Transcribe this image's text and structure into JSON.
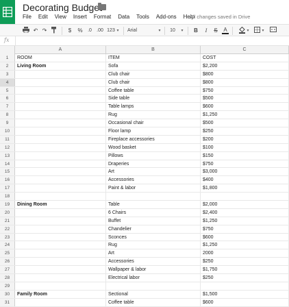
{
  "title_bar": {
    "doc_title": "Decorating Budget",
    "save_status": "All changes saved in Drive"
  },
  "menu": [
    "File",
    "Edit",
    "View",
    "Insert",
    "Format",
    "Data",
    "Tools",
    "Add-ons",
    "Help"
  ],
  "toolbar": {
    "currency": "$",
    "percent": "%",
    "decrease_decimals": ".0",
    "increase_decimals": ".00",
    "more_formats": "123",
    "font": "Arial",
    "font_size": "10",
    "bold": "B",
    "italic": "I",
    "strikethrough": "S",
    "text_color": "A"
  },
  "formula_bar": {
    "fx_label": "fx",
    "value": ""
  },
  "columns": [
    "A",
    "B",
    "C"
  ],
  "rows": [
    {
      "n": "1",
      "a": "ROOM",
      "b": "ITEM",
      "c": "COST"
    },
    {
      "n": "2",
      "a": "Living Room",
      "b": "Sofa",
      "c": "$2,200",
      "bold_a": true
    },
    {
      "n": "3",
      "a": "",
      "b": "Club chair",
      "c": "$800"
    },
    {
      "n": "4",
      "a": "",
      "b": "Club chair",
      "c": "$800",
      "selected": true
    },
    {
      "n": "5",
      "a": "",
      "b": "Coffee table",
      "c": "$750"
    },
    {
      "n": "6",
      "a": "",
      "b": "Side table",
      "c": "$500"
    },
    {
      "n": "7",
      "a": "",
      "b": "Table lamps",
      "c": "$600"
    },
    {
      "n": "8",
      "a": "",
      "b": "Rug",
      "c": "$1,250"
    },
    {
      "n": "9",
      "a": "",
      "b": "Occasional chair",
      "c": "$500"
    },
    {
      "n": "10",
      "a": "",
      "b": "Floor lamp",
      "c": "$250"
    },
    {
      "n": "11",
      "a": "",
      "b": "Fireplace accessories",
      "c": "$200"
    },
    {
      "n": "12",
      "a": "",
      "b": "Wood basket",
      "c": "$100"
    },
    {
      "n": "13",
      "a": "",
      "b": "Pillows",
      "c": "$150"
    },
    {
      "n": "14",
      "a": "",
      "b": "Draperies",
      "c": "$750"
    },
    {
      "n": "15",
      "a": "",
      "b": "Art",
      "c": "$3,000"
    },
    {
      "n": "16",
      "a": "",
      "b": "Accessories",
      "c": "$400"
    },
    {
      "n": "17",
      "a": "",
      "b": "Paint & labor",
      "c": "$1,800"
    },
    {
      "n": "18",
      "a": "",
      "b": "",
      "c": ""
    },
    {
      "n": "19",
      "a": "Dining Room",
      "b": "Table",
      "c": "$2,000",
      "bold_a": true
    },
    {
      "n": "20",
      "a": "",
      "b": "6 Chairs",
      "c": "$2,400"
    },
    {
      "n": "21",
      "a": "",
      "b": "Buffet",
      "c": "$1,250"
    },
    {
      "n": "22",
      "a": "",
      "b": "Chandelier",
      "c": "$750"
    },
    {
      "n": "23",
      "a": "",
      "b": "Sconces",
      "c": "$600"
    },
    {
      "n": "24",
      "a": "",
      "b": "Rug",
      "c": "$1,250"
    },
    {
      "n": "25",
      "a": "",
      "b": "Art",
      "c": "2000"
    },
    {
      "n": "26",
      "a": "",
      "b": "Accessories",
      "c": "$250"
    },
    {
      "n": "27",
      "a": "",
      "b": "Wallpaper & labor",
      "c": "$1,750"
    },
    {
      "n": "28",
      "a": "",
      "b": "Electrical labor",
      "c": "$250"
    },
    {
      "n": "29",
      "a": "",
      "b": "",
      "c": ""
    },
    {
      "n": "30",
      "a": "Family Room",
      "b": "Sectional",
      "c": "$1,500",
      "bold_a": true
    },
    {
      "n": "31",
      "a": "",
      "b": "Coffee table",
      "c": "$600"
    }
  ],
  "colors": {
    "sheets_green": "#0f9d58",
    "header_bg": "#f3f3f3",
    "selected_row_header": "#dddddd",
    "text_color_bar": "#222222"
  }
}
